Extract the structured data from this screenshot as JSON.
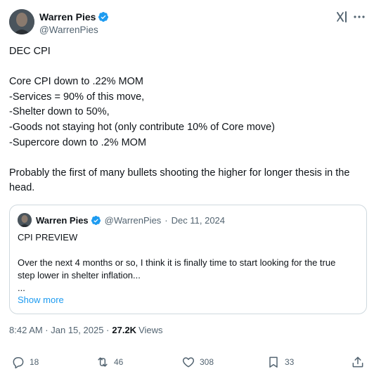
{
  "author": {
    "name": "Warren Pies",
    "handle": "@WarrenPies",
    "verified": true
  },
  "header_icons": [
    "grok-icon",
    "more-options-icon"
  ],
  "tweet": {
    "lines": [
      "DEC CPI",
      "",
      "Core CPI down to .22% MOM",
      "-Services = 90% of this move,",
      "-Shelter down to 50%,",
      "-Goods not staying hot (only contribute 10% of Core move)",
      "-Supercore down to .2% MOM",
      "",
      "Probably the first of many bullets shooting the higher for longer thesis in the head."
    ]
  },
  "quoted": {
    "name": "Warren Pies",
    "handle": "@WarrenPies",
    "separator": "·",
    "date": "Dec 11, 2024",
    "lines": [
      "CPI PREVIEW",
      "",
      "Over the next 4 months or so, I think it is finally time to start looking for the true step lower in shelter inflation...",
      "..."
    ],
    "show_more": "Show more"
  },
  "meta": {
    "time": "8:42 AM · Jan 15, 2025 ·",
    "views_count": "27.2K",
    "views_label": "Views"
  },
  "actions": {
    "reply": "18",
    "retweet": "46",
    "like": "308",
    "bookmark": "33"
  },
  "colors": {
    "verified": "#1d9bf0",
    "link": "#1d9bf0",
    "secondary_text": "#536471",
    "border": "#cfd9de"
  }
}
